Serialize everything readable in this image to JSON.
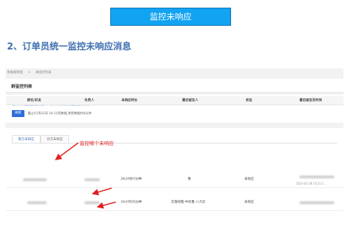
{
  "banner": {
    "title": "监控未响应"
  },
  "heading": {
    "text": "2、订单员统一监控未响应消息"
  },
  "breadcrumb": [
    "客服群管理",
    "群监控列表"
  ],
  "panel_title": "群监控列表",
  "info": {
    "line1": "超时未响应提醒已开启,每5分钟,将聚焦发送给相关负责人。",
    "refresh_label": "刷新",
    "note": "截止01月22日 16:15的数据,更新数据约8分钟"
  },
  "tabs": [
    {
      "label": "我方未响应",
      "active": true
    },
    {
      "label": "对方未响应",
      "active": false
    }
  ],
  "annotation": "监控哪个未响应",
  "table": {
    "columns": [
      "群名/好友",
      "负责人",
      "未响应时长",
      "最后留言人",
      "状态",
      "最后留言及时间"
    ],
    "rows": [
      {
        "duration": "26小时07分钟",
        "last_person": "曹",
        "status": "未响应",
        "time": "2023-02-28 16:21:2..."
      },
      {
        "duration": "10小时35分钟",
        "last_person": "实施经理-中房鲁-八爪云",
        "status": "未响应",
        "time": ""
      }
    ]
  },
  "colors": {
    "banner_bg": "#12a3f2",
    "heading": "#3f6fb0",
    "annotation": "#e02020",
    "primary_button": "#2f6fd8"
  }
}
